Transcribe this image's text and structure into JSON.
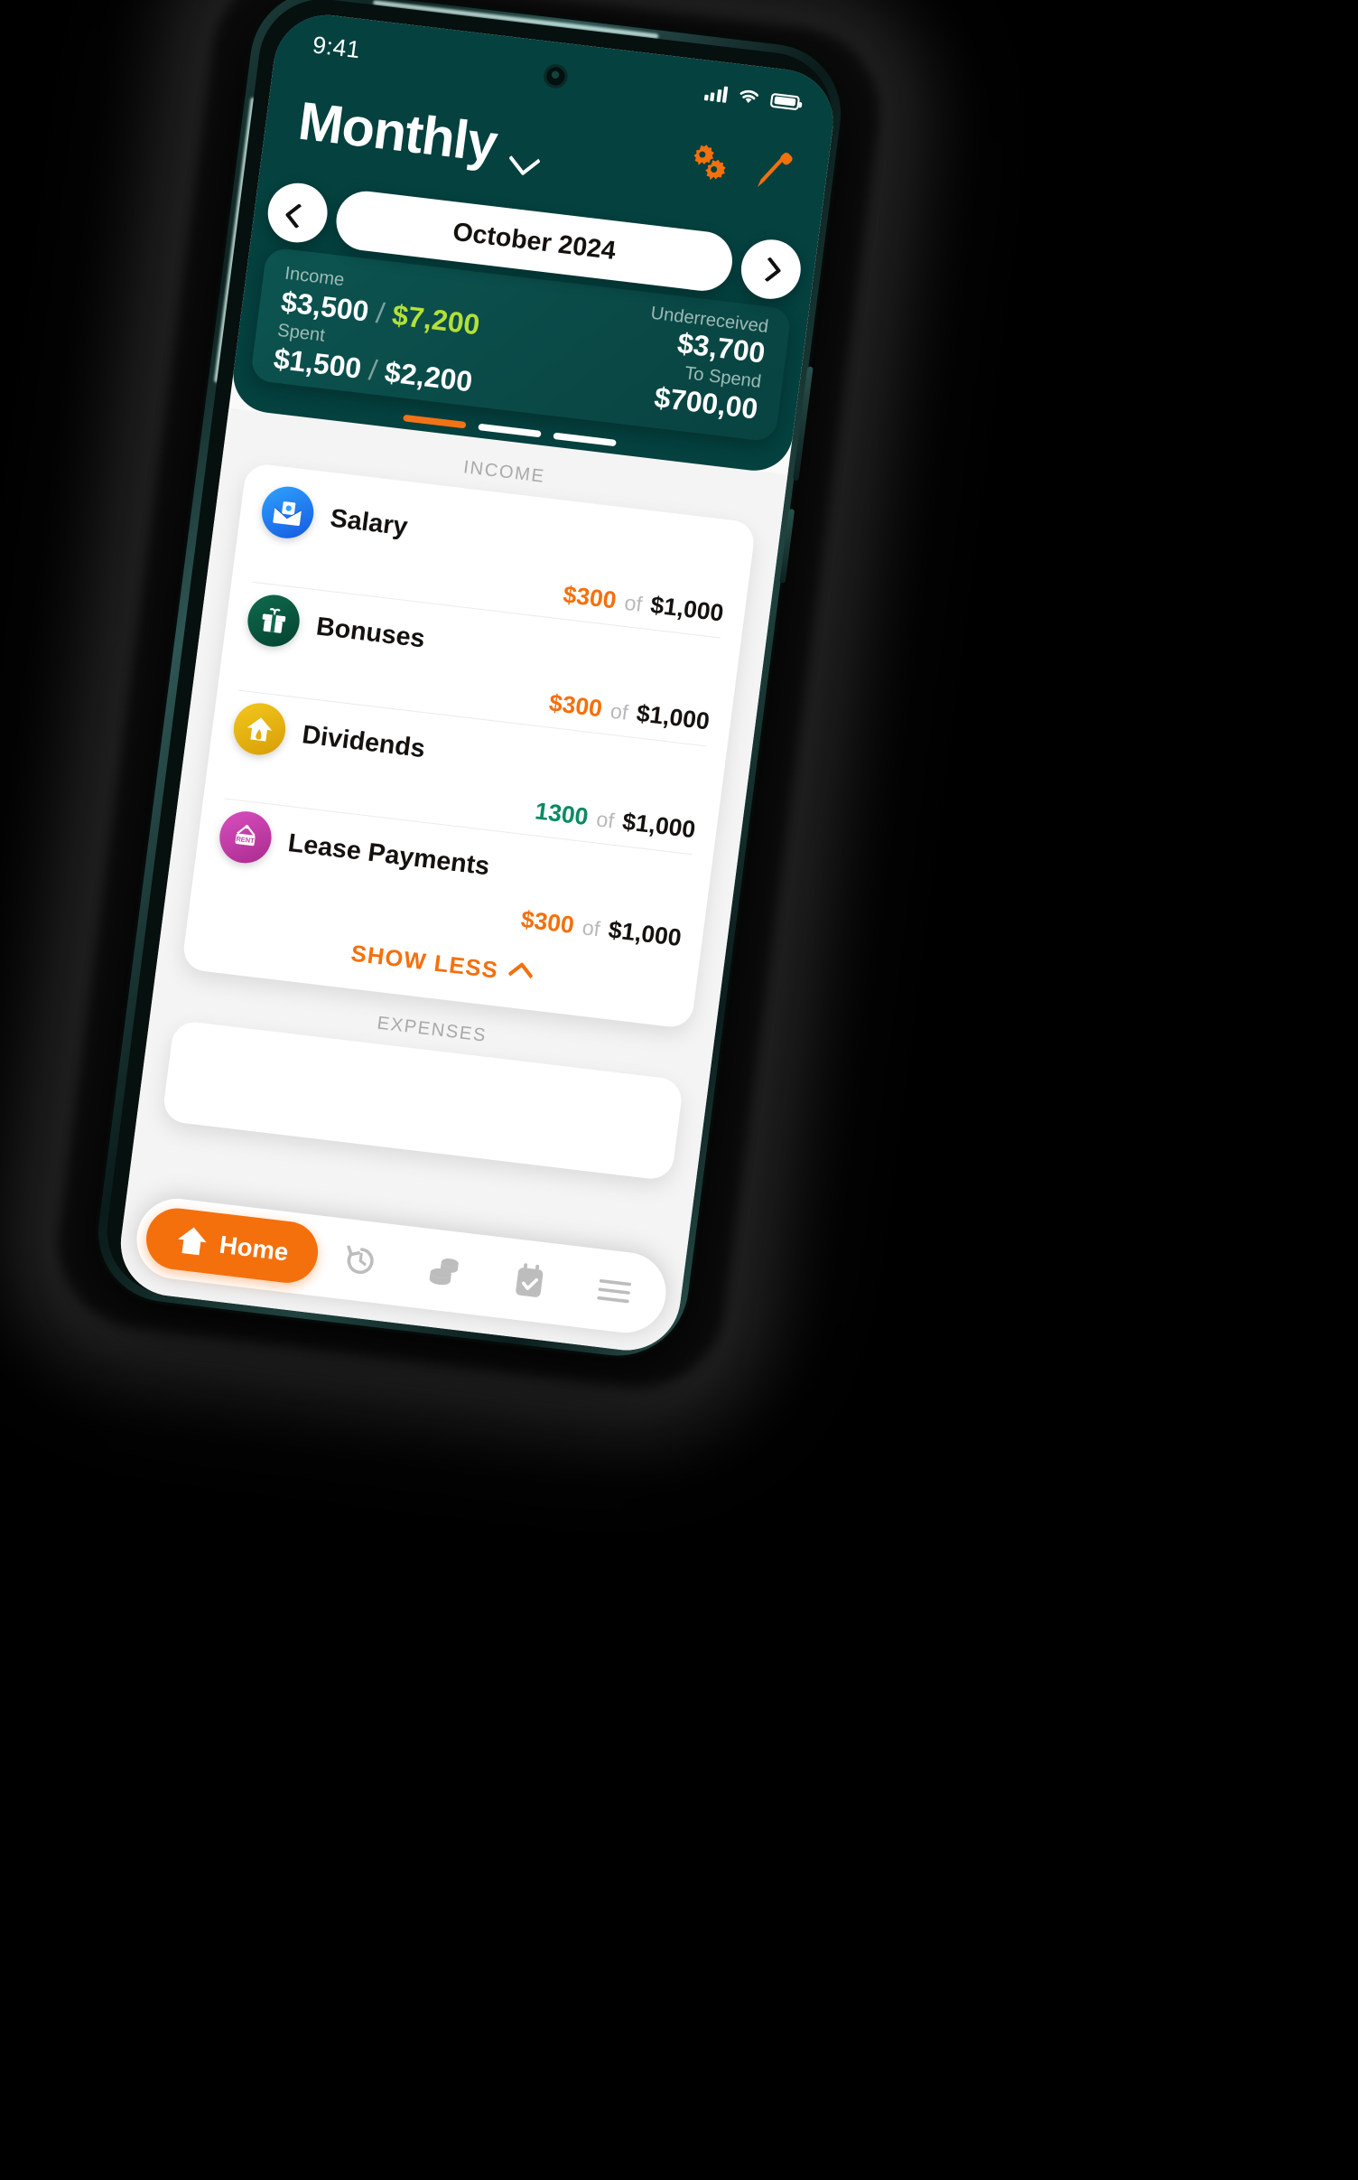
{
  "status_bar": {
    "time": "9:41",
    "signal_icon": "cellular-signal-icon",
    "wifi_icon": "wifi-icon",
    "battery_icon": "battery-icon"
  },
  "header": {
    "title": "Monthly",
    "title_caret_icon": "chevron-down-icon",
    "settings_icon": "gears-icon",
    "edit_icon": "pencil-icon",
    "accent_orange": "#F4700D",
    "background": "#04413F"
  },
  "month_selector": {
    "prev_icon": "chevron-left-icon",
    "next_icon": "chevron-right-icon",
    "current": "October 2024"
  },
  "summary": {
    "income_label": "Income",
    "income_current": "$3,500",
    "income_separator": "/",
    "income_goal": "$7,200",
    "income_goal_color": "#B4E037",
    "spent_label": "Spent",
    "spent_current": "$1,500",
    "spent_separator": "/",
    "spent_goal": "$2,200",
    "underreceived_label": "Underreceived",
    "underreceived_value": "$3,700",
    "to_spend_label": "To Spend",
    "to_spend_value": "$700,00"
  },
  "pager": {
    "active_index": 0,
    "count": 3
  },
  "income_section": {
    "label": "INCOME",
    "items": [
      {
        "name": "Salary",
        "icon": "money-envelope-icon",
        "icon_color": "#1E7CF5",
        "current": "$300",
        "current_color": "#F4700D",
        "of": "of",
        "total": "$1,000"
      },
      {
        "name": "Bonuses",
        "icon": "gift-icon",
        "icon_color": "#0B5B45",
        "current": "$300",
        "current_color": "#F4700D",
        "of": "of",
        "total": "$1,000"
      },
      {
        "name": "Dividends",
        "icon": "house-icon",
        "icon_color": "#E9B511",
        "current": "1300",
        "current_color": "#0B8A63",
        "of": "of",
        "total": "$1,000"
      },
      {
        "name": "Lease Payments",
        "icon": "rent-sign-icon",
        "icon_color": "#C43BA5",
        "current": "$300",
        "current_color": "#F4700D",
        "of": "of",
        "total": "$1,000"
      }
    ],
    "show_less_label": "SHOW LESS",
    "show_less_icon": "chevron-up-icon"
  },
  "expenses_section": {
    "label": "EXPENSES"
  },
  "tabbar": {
    "items": [
      {
        "label": "Home",
        "icon": "home-icon",
        "active": true
      },
      {
        "label": "",
        "icon": "history-icon",
        "active": false
      },
      {
        "label": "",
        "icon": "coins-icon",
        "active": false
      },
      {
        "label": "",
        "icon": "calendar-check-icon",
        "active": false
      },
      {
        "label": "",
        "icon": "menu-icon",
        "active": false
      }
    ]
  }
}
